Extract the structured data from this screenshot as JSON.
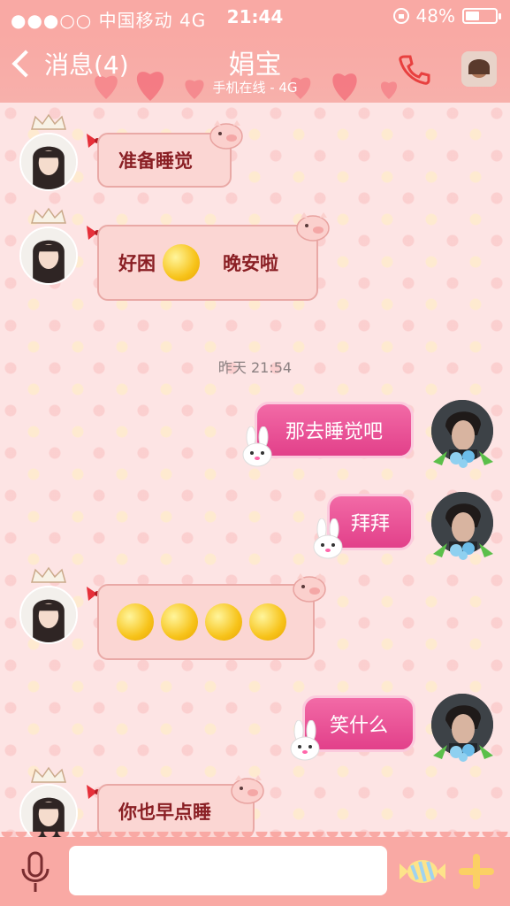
{
  "status_bar": {
    "carrier": "●●●○○ 中国移动  4G",
    "time": "21:44",
    "battery": "48%",
    "battery_level": 0.48
  },
  "nav": {
    "back_label": "消息(4)",
    "title": "娟宝",
    "subtitle": "手机在线 - 4G"
  },
  "timestamp": "昨天 21:54",
  "messages": [
    {
      "side": "left",
      "text": "准备睡觉"
    },
    {
      "side": "left",
      "text_a": "好困",
      "text_b": "晚安啦"
    },
    {
      "side": "right",
      "text": "那去睡觉吧"
    },
    {
      "side": "right",
      "text": "拜拜"
    },
    {
      "side": "left",
      "text": ""
    },
    {
      "side": "right",
      "text": "笑什么"
    },
    {
      "side": "left",
      "text": "你也早点睡"
    }
  ],
  "input": {
    "placeholder": ""
  },
  "colors": {
    "header": "#f9a9a4",
    "bubble_left": "#fbd6d3",
    "bubble_right": "#e2408a",
    "left_text": "#8a1f24"
  }
}
